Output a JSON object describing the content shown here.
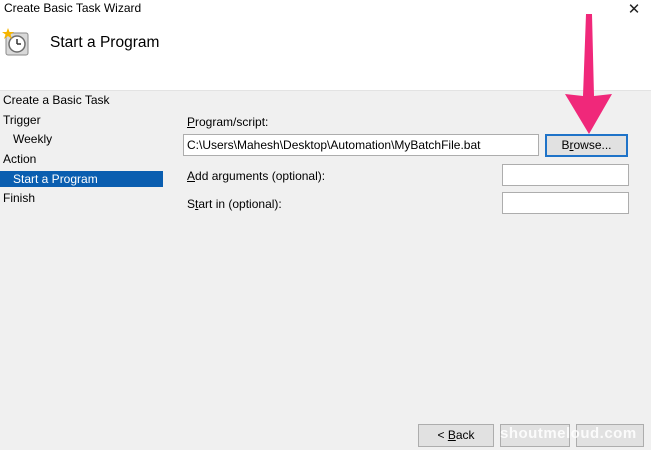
{
  "window": {
    "title": "Create Basic Task Wizard",
    "close_glyph": "✕"
  },
  "header": {
    "title": "Start a Program",
    "icon": "task-scheduler-clock-icon"
  },
  "nav": {
    "items": [
      {
        "label": "Create a Basic Task",
        "indent": false,
        "active": false
      },
      {
        "label": "Trigger",
        "indent": false,
        "active": false
      },
      {
        "label": "Weekly",
        "indent": true,
        "active": false
      },
      {
        "label": "Action",
        "indent": false,
        "active": false
      },
      {
        "label": "Start a Program",
        "indent": true,
        "active": true
      },
      {
        "label": "Finish",
        "indent": false,
        "active": false
      }
    ]
  },
  "form": {
    "program_label_ul": "P",
    "program_label_rest": "rogram/script:",
    "program_value": "C:\\Users\\Mahesh\\Desktop\\Automation\\MyBatchFile.bat",
    "browse_ul": "r",
    "browse_pre": "B",
    "browse_post": "owse...",
    "args_label_ul": "A",
    "args_label_rest": "dd arguments (optional):",
    "args_value": "",
    "start_label_pre": "S",
    "start_label_ul": "t",
    "start_label_rest": "art in (optional):",
    "start_value": ""
  },
  "footer": {
    "back_pre": "< ",
    "back_ul": "B",
    "back_rest": "ack",
    "next_label": "",
    "cancel_label": ""
  },
  "watermark": {
    "text": "shoutmeloud.com"
  },
  "colors": {
    "accent": "#0a5eb0",
    "arrow": "#f0287a",
    "content_bg": "#f0f0f0"
  }
}
